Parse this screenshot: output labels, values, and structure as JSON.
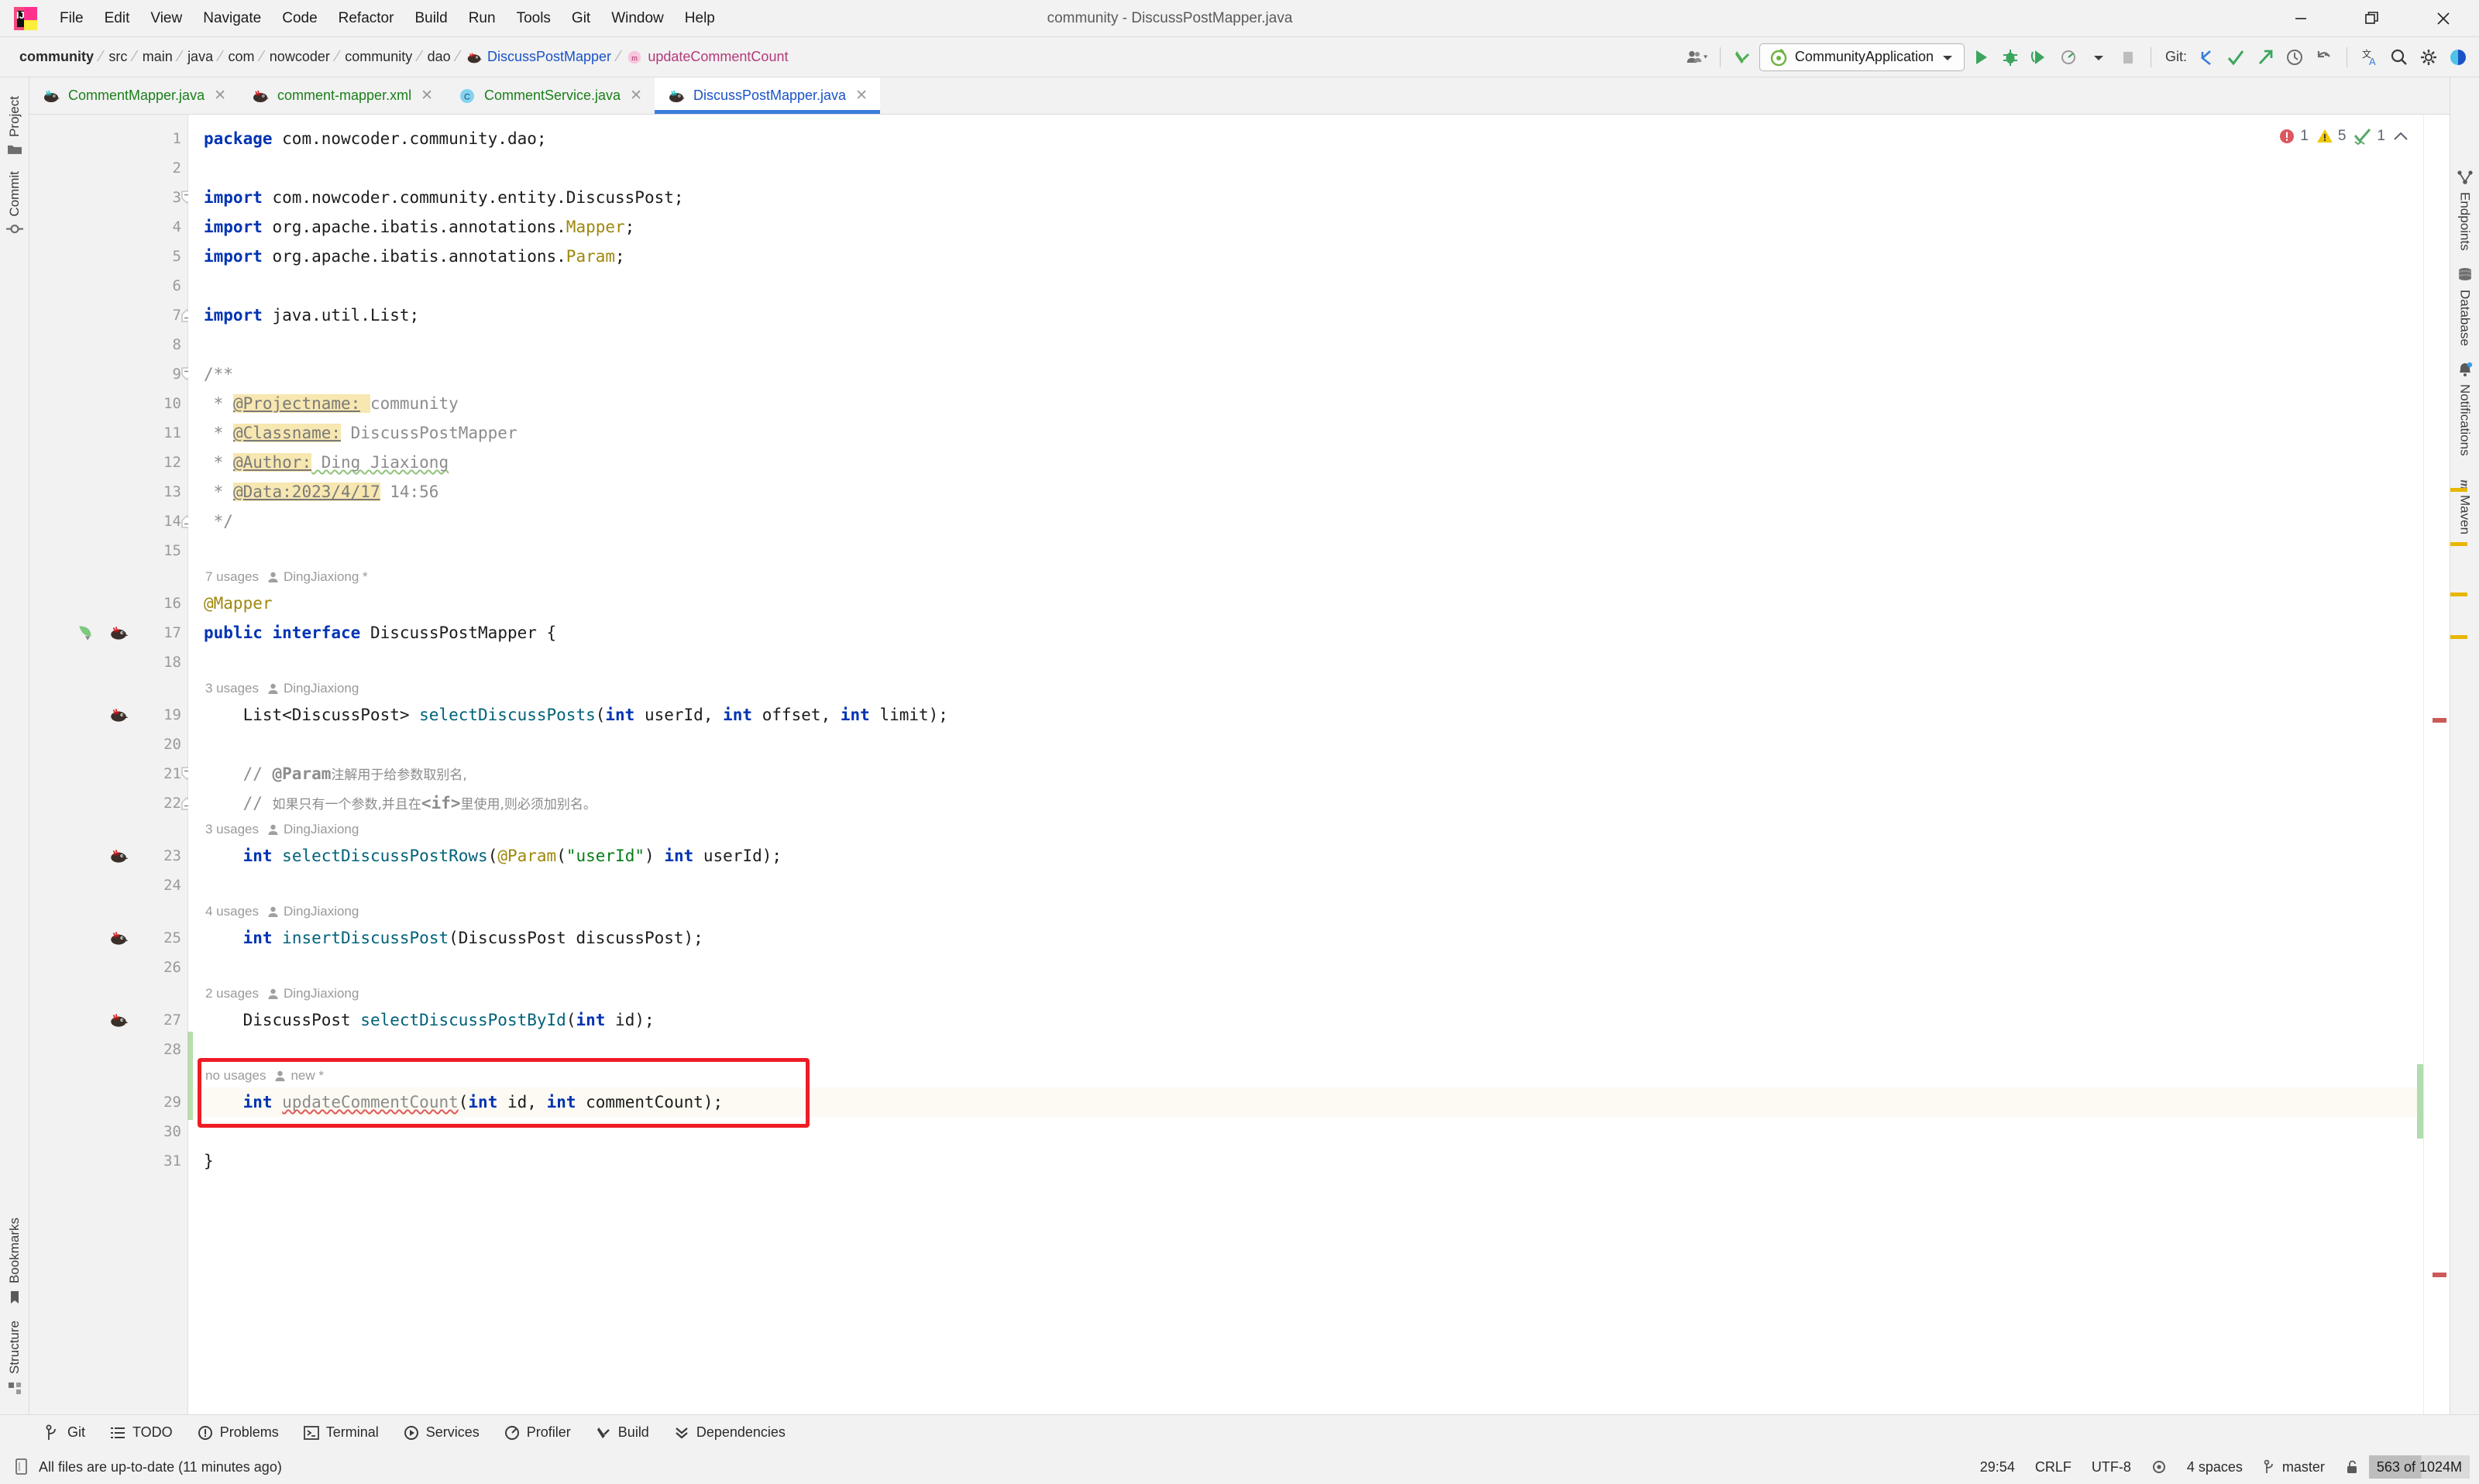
{
  "window": {
    "title": "community - DiscussPostMapper.java",
    "minimize": "minimize-icon",
    "restore": "restore-icon",
    "close": "close-icon"
  },
  "menu": {
    "items": [
      "File",
      "Edit",
      "View",
      "Navigate",
      "Code",
      "Refactor",
      "Build",
      "Run",
      "Tools",
      "Git",
      "Window",
      "Help"
    ]
  },
  "breadcrumbs": [
    {
      "label": "community",
      "style": "bold"
    },
    {
      "label": "src",
      "style": "plain"
    },
    {
      "label": "main",
      "style": "plain"
    },
    {
      "label": "java",
      "style": "plain"
    },
    {
      "label": "com",
      "style": "plain"
    },
    {
      "label": "nowcoder",
      "style": "plain"
    },
    {
      "label": "community",
      "style": "plain"
    },
    {
      "label": "dao",
      "style": "plain"
    },
    {
      "label": "DiscussPostMapper",
      "style": "blue",
      "icon": "interface-mybatis-icon"
    },
    {
      "label": "updateCommentCount",
      "style": "pink",
      "icon": "method-icon"
    }
  ],
  "toolbar": {
    "user_icon": "user-avatar-dropdown-icon",
    "build_icon": "build-hammer-icon",
    "run_config": "CommunityApplication",
    "run_config_icon": "spring-boot-icon",
    "run_icon": "run-icon",
    "debug_icon": "debug-icon",
    "run_coverage_icon": "run-with-coverage-icon",
    "profile_icon": "profile-icon",
    "stop_icon": "stop-icon",
    "git_label": "Git:",
    "git_update_icon": "git-update-project-icon",
    "git_commit_icon": "git-commit-icon",
    "git_push_icon": "git-push-icon",
    "history_icon": "history-icon",
    "rollback_icon": "rollback-icon",
    "translate_icon": "translate-icon",
    "search_icon": "search-everywhere-icon",
    "settings_icon": "settings-gear-icon",
    "theme_icon": "theme-toggle-icon"
  },
  "editor_tabs": [
    {
      "label": "CommentMapper.java",
      "icon": "mybatis-mapper-icon",
      "active": false
    },
    {
      "label": "comment-mapper.xml",
      "icon": "mybatis-xml-icon",
      "active": false
    },
    {
      "label": "CommentService.java",
      "icon": "class-icon",
      "active": false
    },
    {
      "label": "DiscussPostMapper.java",
      "icon": "mybatis-mapper-icon",
      "active": true
    }
  ],
  "left_strip": {
    "top": [
      {
        "label": "Project",
        "icon": "project-folder-icon"
      },
      {
        "label": "Commit",
        "icon": "commit-icon"
      }
    ],
    "bottom": [
      {
        "label": "Bookmarks",
        "icon": "bookmark-icon"
      },
      {
        "label": "Structure",
        "icon": "structure-icon"
      }
    ]
  },
  "right_strip": {
    "top": [
      {
        "label": "Endpoints",
        "icon": "endpoints-icon"
      },
      {
        "label": "Database",
        "icon": "database-icon"
      },
      {
        "label": "Notifications",
        "icon": "notifications-bell-icon"
      },
      {
        "label": "Maven",
        "icon": "maven-m-icon"
      }
    ]
  },
  "inspection": {
    "errors": "1",
    "warnings": "5",
    "oks": "1",
    "error_icon": "error-circle-icon",
    "warning_icon": "warning-triangle-icon",
    "ok_icon": "inspection-ok-icon",
    "collapse_icon": "chevron-up-icon"
  },
  "code": {
    "file": "DiscussPostMapper.java",
    "lines": [
      {
        "n": "1",
        "tokens": [
          {
            "t": "package",
            "c": "kw"
          },
          {
            "t": " com.nowcoder.community.dao;",
            "c": ""
          }
        ]
      },
      {
        "n": "2",
        "tokens": []
      },
      {
        "n": "3",
        "tokens": [
          {
            "t": "import",
            "c": "kw"
          },
          {
            "t": " com.nowcoder.community.entity.DiscussPost;",
            "c": ""
          }
        ],
        "fold": "start"
      },
      {
        "n": "4",
        "tokens": [
          {
            "t": "import",
            "c": "kw"
          },
          {
            "t": " org.apache.ibatis.annotations.",
            "c": ""
          },
          {
            "t": "Mapper",
            "c": "ann"
          },
          {
            "t": ";",
            "c": ""
          }
        ]
      },
      {
        "n": "5",
        "tokens": [
          {
            "t": "import",
            "c": "kw"
          },
          {
            "t": " org.apache.ibatis.annotations.",
            "c": ""
          },
          {
            "t": "Param",
            "c": "ann"
          },
          {
            "t": ";",
            "c": ""
          }
        ]
      },
      {
        "n": "6",
        "tokens": []
      },
      {
        "n": "7",
        "tokens": [
          {
            "t": "import",
            "c": "kw"
          },
          {
            "t": " java.util.List;",
            "c": ""
          }
        ],
        "fold": "end"
      },
      {
        "n": "8",
        "tokens": []
      },
      {
        "n": "9",
        "tokens": [
          {
            "t": "/**",
            "c": "doc"
          }
        ],
        "fold": "start"
      },
      {
        "n": "10",
        "tokens": [
          {
            "t": " * ",
            "c": "doc"
          },
          {
            "t": "@Projectname:",
            "c": "doctag"
          },
          {
            "t": " ",
            "c": "hl"
          },
          {
            "t": "community",
            "c": "doc"
          }
        ]
      },
      {
        "n": "11",
        "tokens": [
          {
            "t": " * ",
            "c": "doc"
          },
          {
            "t": "@Classname:",
            "c": "doctag"
          },
          {
            "t": " DiscussPostMapper",
            "c": "doc"
          }
        ]
      },
      {
        "n": "12",
        "tokens": [
          {
            "t": " * ",
            "c": "doc"
          },
          {
            "t": "@Author:",
            "c": "doctag"
          },
          {
            "t": " Ding Jiaxiong",
            "c": "doc warn-u"
          }
        ]
      },
      {
        "n": "13",
        "tokens": [
          {
            "t": " * ",
            "c": "doc"
          },
          {
            "t": "@Data:2023/4/17",
            "c": "doctag"
          },
          {
            "t": " 14:56",
            "c": "doc"
          }
        ]
      },
      {
        "n": "14",
        "tokens": [
          {
            "t": " */",
            "c": "doc"
          }
        ],
        "fold": "end"
      },
      {
        "n": "15",
        "tokens": []
      },
      {
        "n": "16",
        "tokens": [
          {
            "t": "@Mapper",
            "c": "ann"
          }
        ],
        "hint": {
          "usages": "7 usages",
          "author": "DingJiaxiong *"
        }
      },
      {
        "n": "17",
        "tokens": [
          {
            "t": "public",
            "c": "kw"
          },
          {
            "t": " ",
            "c": ""
          },
          {
            "t": "interface",
            "c": "kw"
          },
          {
            "t": " DiscussPostMapper {",
            "c": ""
          }
        ],
        "gutter": [
          "spring-bean-icon",
          "mybatis-bird-icon"
        ]
      },
      {
        "n": "18",
        "tokens": []
      },
      {
        "n": "19",
        "tokens": [
          {
            "t": "    List<DiscussPost> ",
            "c": ""
          },
          {
            "t": "selectDiscussPosts",
            "c": "mth"
          },
          {
            "t": "(",
            "c": ""
          },
          {
            "t": "int",
            "c": "kw"
          },
          {
            "t": " userId, ",
            "c": ""
          },
          {
            "t": "int",
            "c": "kw"
          },
          {
            "t": " offset, ",
            "c": ""
          },
          {
            "t": "int",
            "c": "kw"
          },
          {
            "t": " limit);",
            "c": ""
          }
        ],
        "hint": {
          "usages": "3 usages",
          "author": "DingJiaxiong"
        },
        "gutter": [
          "mybatis-bird-icon"
        ]
      },
      {
        "n": "20",
        "tokens": []
      },
      {
        "n": "21",
        "tokens": [
          {
            "t": "    // ",
            "c": "cmt"
          },
          {
            "t": "@Param",
            "c": "cmt bold"
          },
          {
            "t": "注解用于给参数取别名,",
            "c": "cmt cjk"
          }
        ],
        "fold": "start"
      },
      {
        "n": "22",
        "tokens": [
          {
            "t": "    // ",
            "c": "cmt"
          },
          {
            "t": "如果只有一个参数,并且在",
            "c": "cmt cjk"
          },
          {
            "t": "<if>",
            "c": "cmt bold"
          },
          {
            "t": "里使用,则必须加别名。",
            "c": "cmt cjk"
          }
        ],
        "fold": "end"
      },
      {
        "n": "23",
        "tokens": [
          {
            "t": "    ",
            "c": ""
          },
          {
            "t": "int",
            "c": "kw"
          },
          {
            "t": " ",
            "c": ""
          },
          {
            "t": "selectDiscussPostRows",
            "c": "mth"
          },
          {
            "t": "(",
            "c": ""
          },
          {
            "t": "@Param",
            "c": "ann"
          },
          {
            "t": "(",
            "c": ""
          },
          {
            "t": "\"userId\"",
            "c": "str"
          },
          {
            "t": ") ",
            "c": ""
          },
          {
            "t": "int",
            "c": "kw"
          },
          {
            "t": " userId);",
            "c": ""
          }
        ],
        "hint": {
          "usages": "3 usages",
          "author": "DingJiaxiong"
        },
        "gutter": [
          "mybatis-bird-icon"
        ]
      },
      {
        "n": "24",
        "tokens": []
      },
      {
        "n": "25",
        "tokens": [
          {
            "t": "    ",
            "c": ""
          },
          {
            "t": "int",
            "c": "kw"
          },
          {
            "t": " ",
            "c": ""
          },
          {
            "t": "insertDiscussPost",
            "c": "mth"
          },
          {
            "t": "(DiscussPost discussPost);",
            "c": ""
          }
        ],
        "hint": {
          "usages": "4 usages",
          "author": "DingJiaxiong"
        },
        "gutter": [
          "mybatis-bird-icon"
        ]
      },
      {
        "n": "26",
        "tokens": []
      },
      {
        "n": "27",
        "tokens": [
          {
            "t": "    DiscussPost ",
            "c": ""
          },
          {
            "t": "selectDiscussPostById",
            "c": "mth"
          },
          {
            "t": "(",
            "c": ""
          },
          {
            "t": "int",
            "c": "kw"
          },
          {
            "t": " id);",
            "c": ""
          }
        ],
        "hint": {
          "usages": "2 usages",
          "author": "DingJiaxiong"
        },
        "gutter": [
          "mybatis-bird-icon"
        ]
      },
      {
        "n": "28",
        "tokens": []
      },
      {
        "n": "29",
        "tokens": [
          {
            "t": "    ",
            "c": ""
          },
          {
            "t": "int",
            "c": "kw"
          },
          {
            "t": " ",
            "c": ""
          },
          {
            "t": "updateCommentCount",
            "c": "err-u"
          },
          {
            "t": "(",
            "c": ""
          },
          {
            "t": "int",
            "c": "kw"
          },
          {
            "t": " id, ",
            "c": ""
          },
          {
            "t": "int",
            "c": "kw"
          },
          {
            "t": " commentCount);",
            "c": ""
          }
        ],
        "hint": {
          "usages": "no usages",
          "author": "new *"
        },
        "current": true,
        "boxed": true
      },
      {
        "n": "30",
        "tokens": []
      },
      {
        "n": "31",
        "tokens": [
          {
            "t": "}",
            "c": ""
          }
        ]
      }
    ]
  },
  "bottom_tools": [
    {
      "label": "Git",
      "icon": "git-branch-icon"
    },
    {
      "label": "TODO",
      "icon": "todo-list-icon"
    },
    {
      "label": "Problems",
      "icon": "problems-icon"
    },
    {
      "label": "Terminal",
      "icon": "terminal-icon"
    },
    {
      "label": "Services",
      "icon": "services-icon"
    },
    {
      "label": "Profiler",
      "icon": "profiler-icon"
    },
    {
      "label": "Build",
      "icon": "build-icon"
    },
    {
      "label": "Dependencies",
      "icon": "dependencies-icon"
    }
  ],
  "status": {
    "message": "All files are up-to-date (11 minutes ago)",
    "message_icon": "vcs-file-icon",
    "caret": "29:54",
    "line_separator": "CRLF",
    "encoding": "UTF-8",
    "indent_icon": "indent-icon",
    "indent": "4 spaces",
    "branch_icon": "git-branch-icon",
    "branch": "master",
    "lock_icon": "unlocked-icon",
    "memory": "563 of 1024M"
  },
  "colors": {
    "accent_blue": "#3a7ddc",
    "link_blue": "#1a53c7",
    "green_tab": "#1a7f1a",
    "keyword": "#0033b3",
    "annotation": "#9e880d",
    "string": "#067d17",
    "method": "#00627a",
    "comment": "#8c8c8c",
    "error_red": "#ee1c25",
    "warn_yellow": "#e8b600",
    "ok_green": "#59a869",
    "highlight_doc": "#f7e7b0",
    "current_line": "#fcfaf2"
  }
}
